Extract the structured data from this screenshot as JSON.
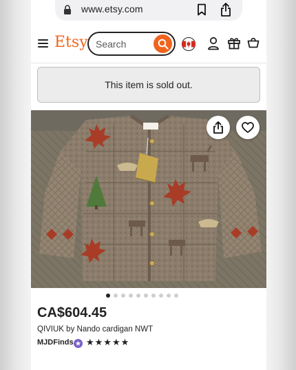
{
  "browser": {
    "url": "www.etsy.com"
  },
  "header": {
    "logo": "Etsy",
    "search_placeholder": "Search"
  },
  "notice": {
    "sold_out": "This item is sold out."
  },
  "gallery": {
    "image_count": 10,
    "active_index": 0
  },
  "listing": {
    "price": "CA$604.45",
    "title": "QIVIUK by Nando cardigan NWT",
    "seller": "MJDFinds",
    "stars": "★★★★★",
    "rating": 5
  },
  "icons": {
    "close": "close-icon",
    "lock": "lock-icon",
    "bookmark": "bookmark-icon",
    "share": "share-icon",
    "more": "more-icon",
    "menu": "hamburger-icon",
    "search": "search-icon",
    "flag": "canada-flag-icon",
    "account": "account-icon",
    "gift": "gift-icon",
    "cart": "cart-icon",
    "favorite": "heart-icon",
    "star_seller": "star-seller-badge-icon"
  },
  "colors": {
    "brand": "#f1641e",
    "star_seller_badge": "#7a5fc9"
  }
}
